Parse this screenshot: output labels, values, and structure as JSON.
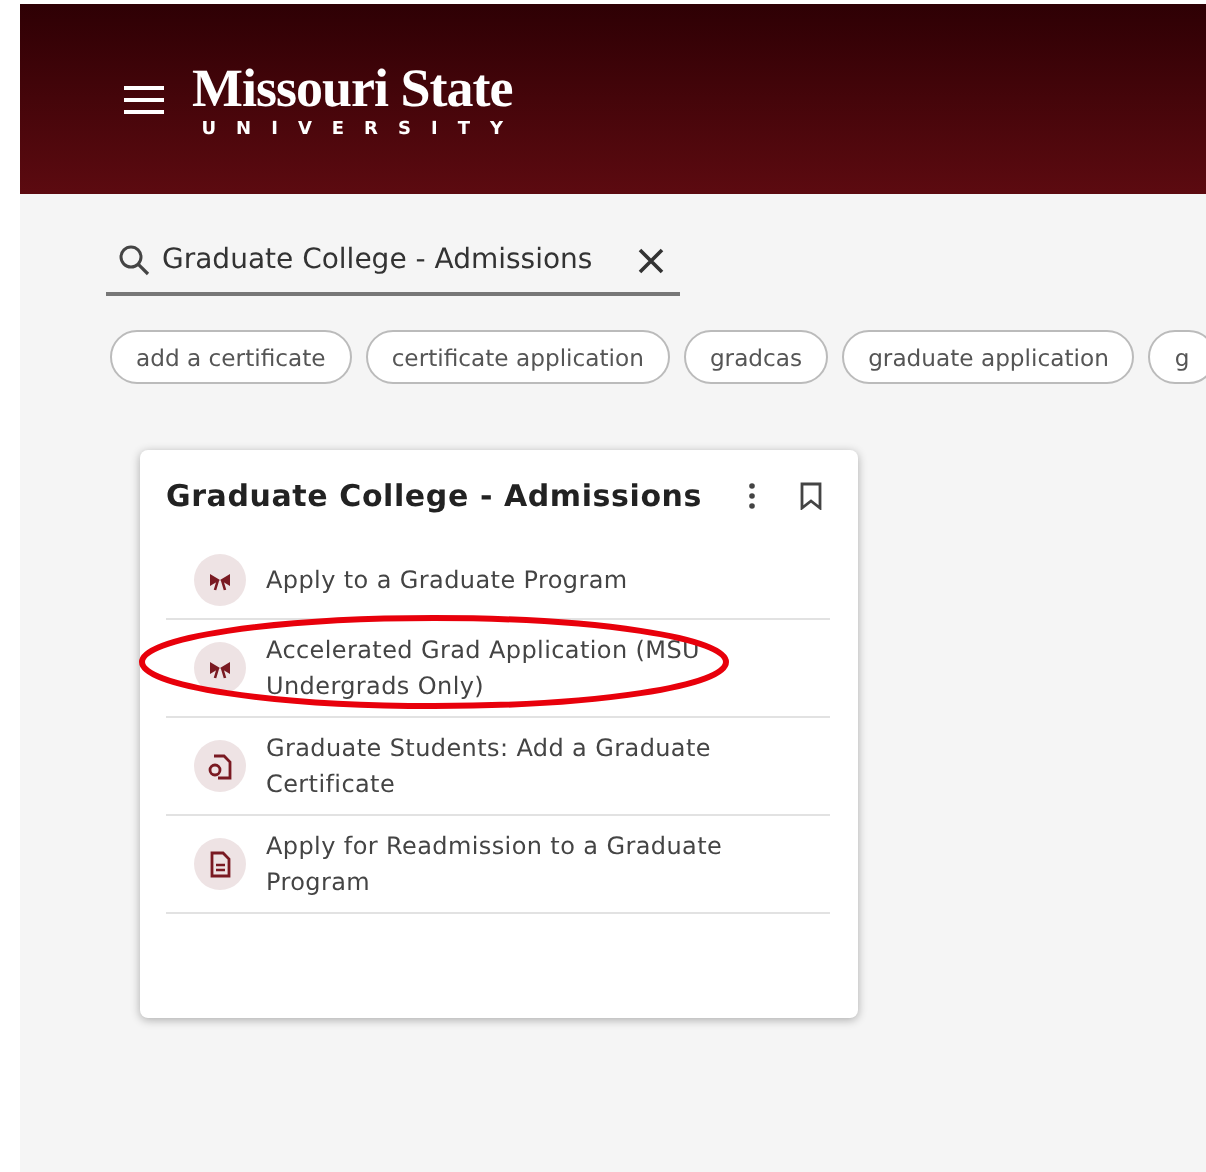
{
  "header": {
    "logo_title": "Missouri State",
    "logo_subtitle": "UNIVERSITY"
  },
  "search": {
    "value": "Graduate College - Admissions"
  },
  "chips": [
    "add a certificate",
    "certificate application",
    "gradcas",
    "graduate application",
    "g"
  ],
  "card": {
    "title": "Graduate College - Admissions",
    "items": [
      {
        "label": "Apply to a Graduate Program",
        "kind": "ribbon",
        "circled": false
      },
      {
        "label": "Accelerated Grad Application (MSU Undergrads Only)",
        "kind": "ribbon",
        "circled": true
      },
      {
        "label": "Graduate Students: Add a Graduate Certificate",
        "kind": "certificate",
        "circled": false
      },
      {
        "label": "Apply for Readmission to a Graduate Program",
        "kind": "document",
        "circled": false
      }
    ]
  }
}
